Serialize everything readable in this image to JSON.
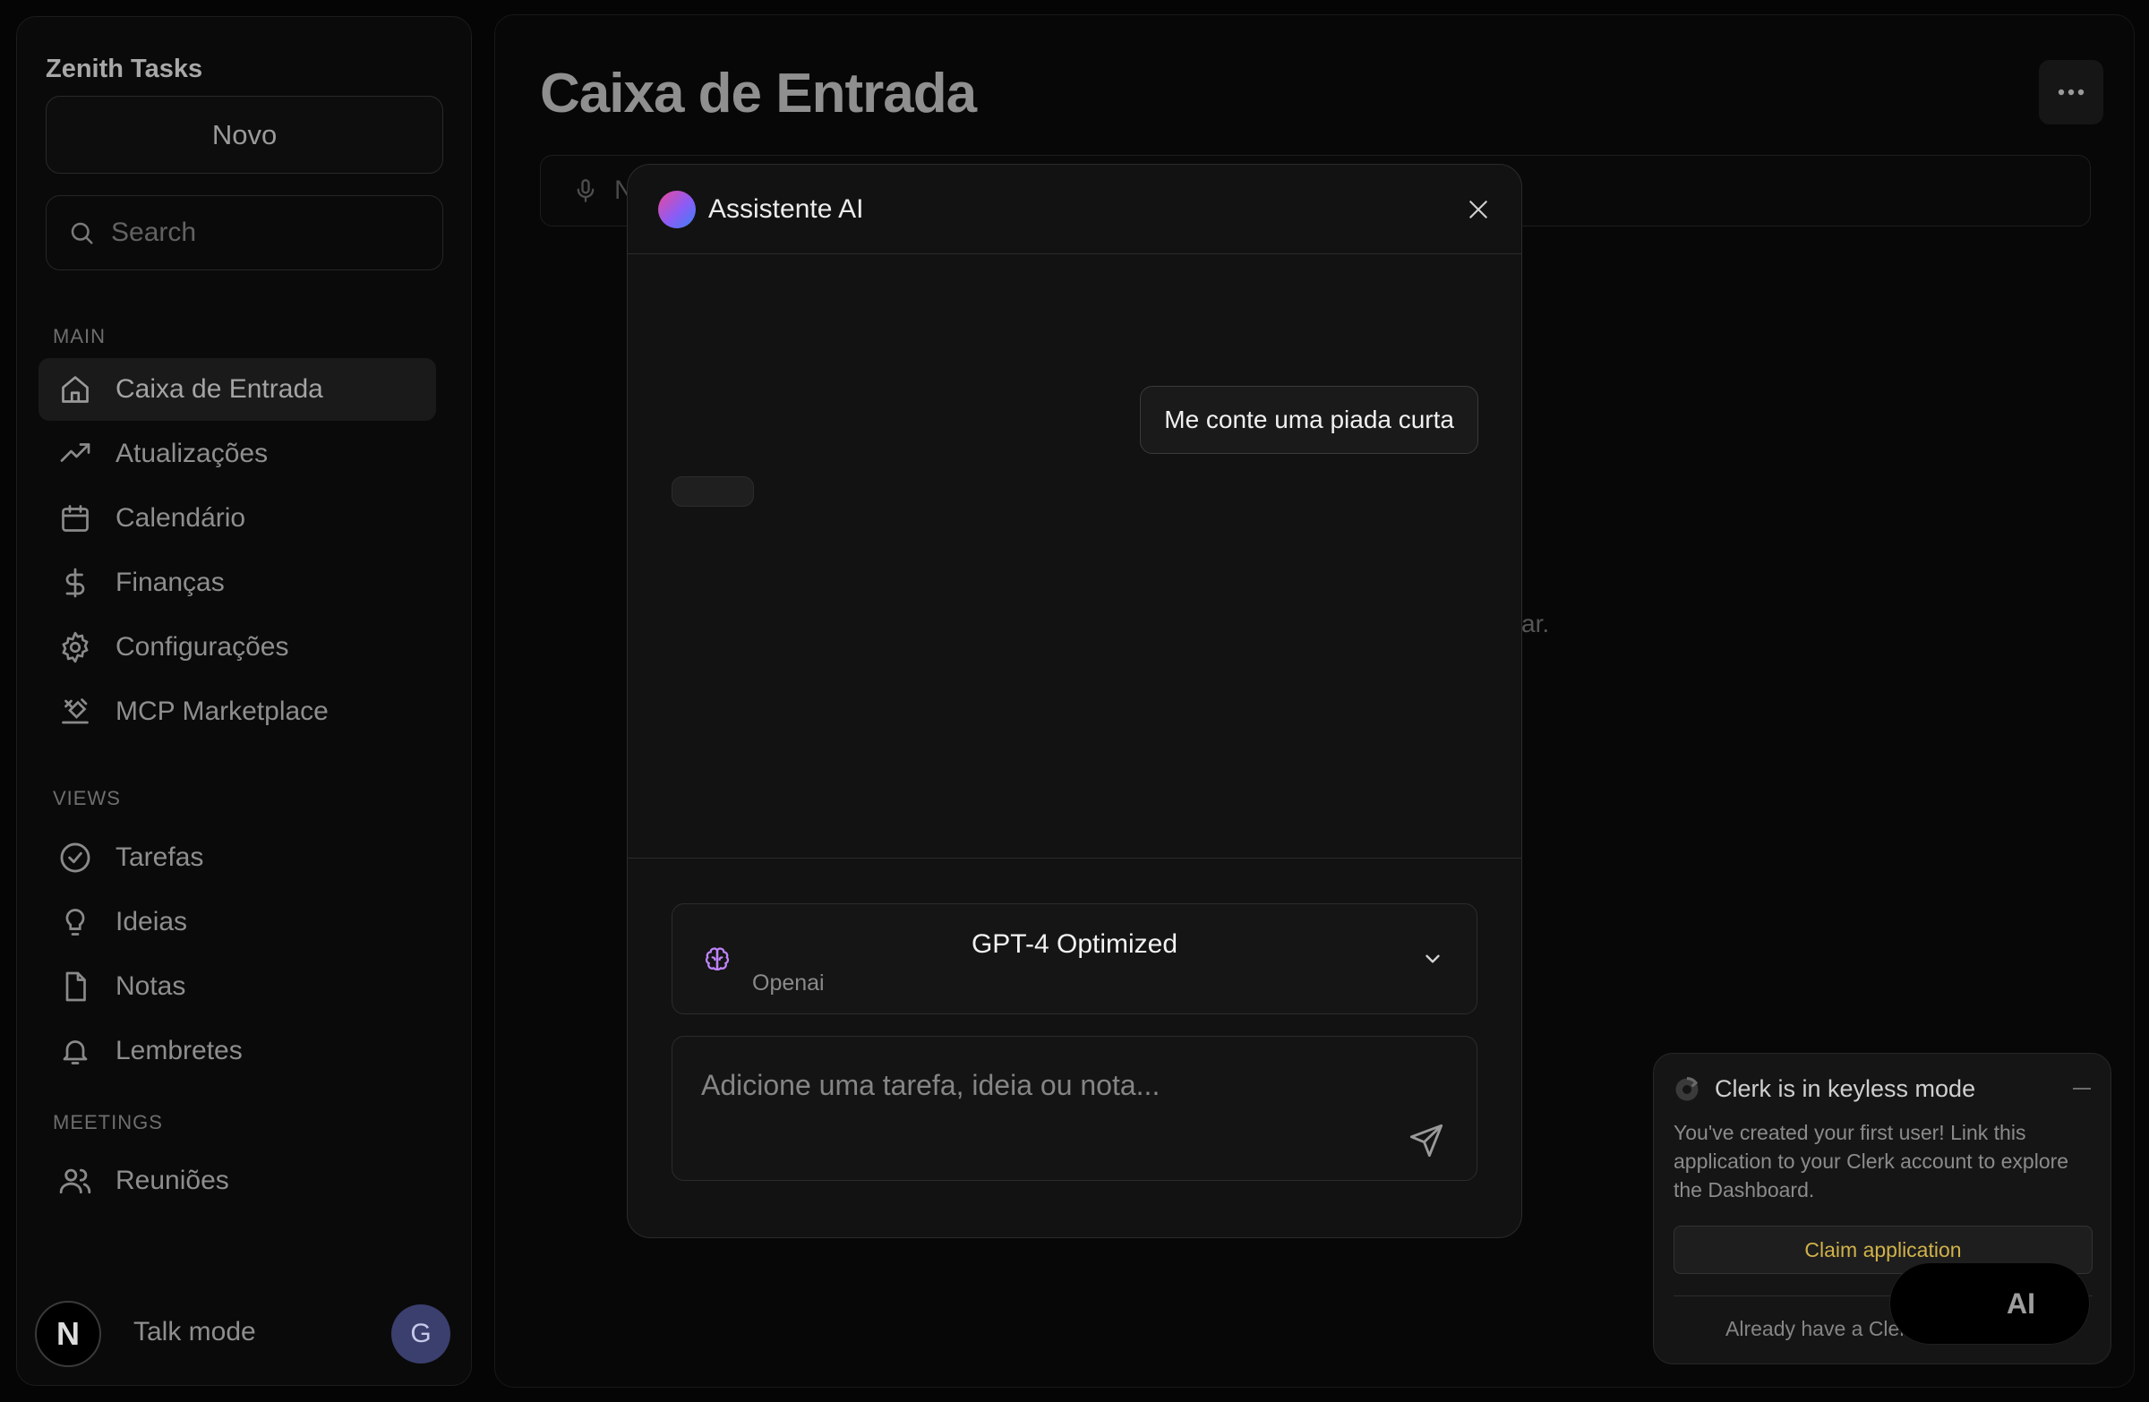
{
  "sidebar": {
    "app_title": "Zenith Tasks",
    "new_button": "Novo",
    "search_placeholder": "Search",
    "sections": {
      "main": "MAIN",
      "views": "VIEWS",
      "meetings": "MEETINGS"
    },
    "main_items": [
      {
        "label": "Caixa de Entrada",
        "icon": "home-icon",
        "active": true
      },
      {
        "label": "Atualizações",
        "icon": "trending-up-icon"
      },
      {
        "label": "Calendário",
        "icon": "calendar-icon"
      },
      {
        "label": "Finanças",
        "icon": "dollar-icon"
      },
      {
        "label": "Configurações",
        "icon": "gear-icon"
      },
      {
        "label": "MCP Marketplace",
        "icon": "sparkle-plug-icon"
      }
    ],
    "view_items": [
      {
        "label": "Tarefas",
        "icon": "check-circle-icon"
      },
      {
        "label": "Ideias",
        "icon": "lightbulb-icon"
      },
      {
        "label": "Notas",
        "icon": "file-icon"
      },
      {
        "label": "Lembretes",
        "icon": "bell-icon"
      }
    ],
    "meeting_items": [
      {
        "label": "Reuniões",
        "icon": "users-icon"
      }
    ],
    "footer": {
      "logo_letter": "N",
      "talk_mode": "Talk mode",
      "avatar_initial": "G"
    }
  },
  "main": {
    "title": "Caixa de Entrada",
    "quick_input_text": "N",
    "empty_state_fragment": "ar."
  },
  "modal": {
    "title": "Assistente AI",
    "messages": [
      {
        "role": "user",
        "text": "Me conte uma piada curta"
      }
    ],
    "model": {
      "name": "GPT-4 Optimized",
      "provider": "Openai"
    },
    "compose_placeholder": "Adicione uma tarefa, ideia ou nota..."
  },
  "clerk": {
    "title": "Clerk is in keyless mode",
    "body": "You've created your first user! Link this application to your Clerk account to explore the Dashboard.",
    "claim_button": "Claim application",
    "footer_text": "Already have a Clerk"
  },
  "ai_button": "AI",
  "colors": {
    "background": "#050505",
    "panel": "#0a0a0a",
    "modal": "#121212",
    "claim_accent": "#d1b24a",
    "avatar": "#3b3f6e"
  }
}
